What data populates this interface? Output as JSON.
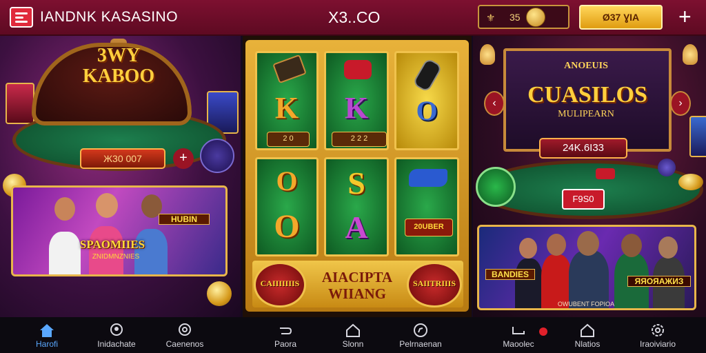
{
  "header": {
    "brand": "IANDNK KASASINO",
    "center_title": "X3..CO",
    "balance_symbols": "⚜",
    "balance_amount": "35",
    "cta_label": "Ø37 ƔIA",
    "plus_label": "+"
  },
  "left_panel": {
    "game_title_line1": "3WY",
    "game_title_line2": "KABOO",
    "stake_value": "Ж30 007",
    "plus_label": "+",
    "banner_text": "SPAOMIIES",
    "banner_subtext": "ZNIDMNZNIES",
    "banner_tag": "HUBIN"
  },
  "middle_panel": {
    "row1": [
      "K",
      "K",
      "O"
    ],
    "row2": [
      "O",
      "S",
      "O"
    ],
    "row3_mid": "A",
    "chip_label": "2   0",
    "chip_label_2": "2 2 2",
    "tile_badge": "20UBER",
    "bottom_line1": "AIACIPTA",
    "bottom_line2": "WIIANG",
    "badge_left": "CAIIIIIIIS",
    "badge_right": "SAIITRIIIS"
  },
  "right_panel": {
    "subtitle_top": "ANOEUIS",
    "game_title": "CUASILOS",
    "subtitle_bottom": "MULIPEARN",
    "jackpot_value": "24K.6I33",
    "chip_value": "F9S0",
    "banner_tag_left": "BANDIES",
    "banner_tag_right": "ЯЯОЯАЖИЗ",
    "banner_caption": "OWUBENT FOPIOA"
  },
  "bottom_nav": {
    "items": [
      {
        "label": "Harofi",
        "icon": "home-icon"
      },
      {
        "label": "Inidachate",
        "icon": "user-icon"
      },
      {
        "label": "Caenenos",
        "icon": "search-icon"
      },
      {
        "label": "Paora",
        "icon": "back-arrow-icon"
      },
      {
        "label": "Slonn",
        "icon": "house-outline-icon"
      },
      {
        "label": "Pelrnaenan",
        "icon": "compass-icon"
      },
      {
        "label": "Maoolec",
        "icon": "return-arrow-icon"
      },
      {
        "label": "Nlatios",
        "icon": "house-outline-icon"
      },
      {
        "label": "Iraoiviario",
        "icon": "settings-icon"
      }
    ]
  },
  "colors": {
    "topbar": "#7d1030",
    "gold": "#e8b23a",
    "nav_active": "#5aa8ff",
    "nav_bg": "#0c0a10"
  }
}
